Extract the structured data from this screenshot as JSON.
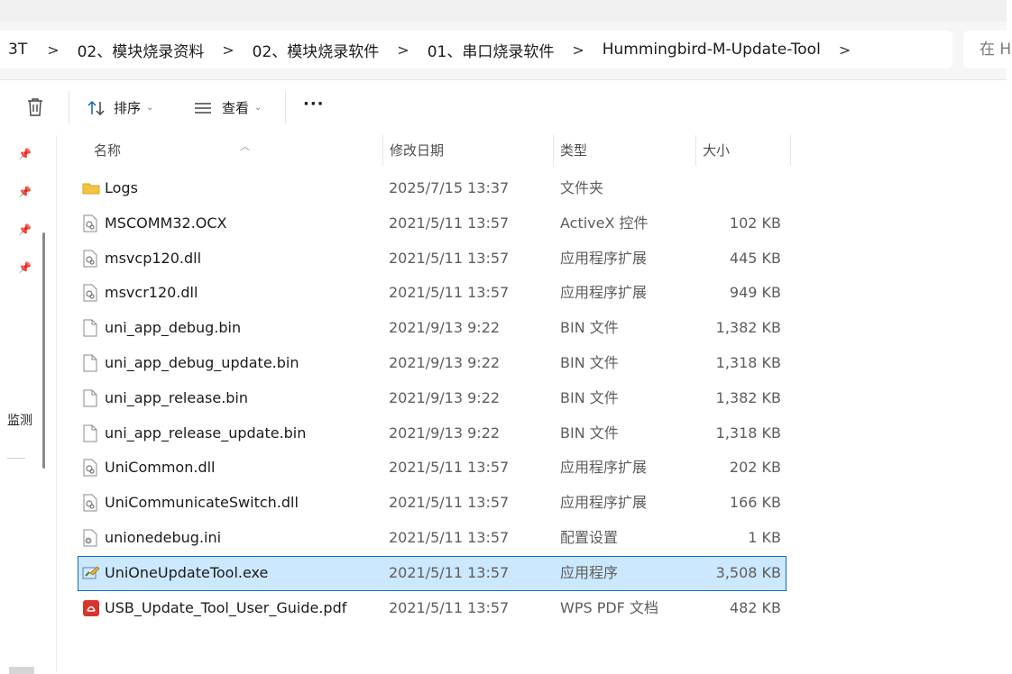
{
  "breadcrumb": {
    "items": [
      "3T",
      "02、模块烧录资料",
      "02、模块烧录软件",
      "01、串口烧录软件",
      "Hummingbird-M-Update-Tool"
    ],
    "separator": ">"
  },
  "search": {
    "placeholder": "在 H"
  },
  "toolbar": {
    "sort_label": "排序",
    "view_label": "查看",
    "more_label": "···"
  },
  "nav": {
    "partial_label": "监测"
  },
  "columns": {
    "name": "名称",
    "date": "修改日期",
    "type": "类型",
    "size": "大小"
  },
  "files": [
    {
      "name": "Logs",
      "date": "2025/7/15 13:37",
      "type": "文件夹",
      "size": "",
      "icon": "folder-icon"
    },
    {
      "name": "MSCOMM32.OCX",
      "date": "2021/5/11 13:57",
      "type": "ActiveX 控件",
      "size": "102 KB",
      "icon": "system-file-icon"
    },
    {
      "name": "msvcp120.dll",
      "date": "2021/5/11 13:57",
      "type": "应用程序扩展",
      "size": "445 KB",
      "icon": "system-file-icon"
    },
    {
      "name": "msvcr120.dll",
      "date": "2021/5/11 13:57",
      "type": "应用程序扩展",
      "size": "949 KB",
      "icon": "system-file-icon"
    },
    {
      "name": "uni_app_debug.bin",
      "date": "2021/9/13 9:22",
      "type": "BIN 文件",
      "size": "1,382 KB",
      "icon": "blank-file-icon"
    },
    {
      "name": "uni_app_debug_update.bin",
      "date": "2021/9/13 9:22",
      "type": "BIN 文件",
      "size": "1,318 KB",
      "icon": "blank-file-icon"
    },
    {
      "name": "uni_app_release.bin",
      "date": "2021/9/13 9:22",
      "type": "BIN 文件",
      "size": "1,382 KB",
      "icon": "blank-file-icon"
    },
    {
      "name": "uni_app_release_update.bin",
      "date": "2021/9/13 9:22",
      "type": "BIN 文件",
      "size": "1,318 KB",
      "icon": "blank-file-icon"
    },
    {
      "name": "UniCommon.dll",
      "date": "2021/5/11 13:57",
      "type": "应用程序扩展",
      "size": "202 KB",
      "icon": "system-file-icon"
    },
    {
      "name": "UniCommunicateSwitch.dll",
      "date": "2021/5/11 13:57",
      "type": "应用程序扩展",
      "size": "166 KB",
      "icon": "system-file-icon"
    },
    {
      "name": "unionedebug.ini",
      "date": "2021/5/11 13:57",
      "type": "配置设置",
      "size": "1 KB",
      "icon": "settings-file-icon"
    },
    {
      "name": "UniOneUpdateTool.exe",
      "date": "2021/5/11 13:57",
      "type": "应用程序",
      "size": "3,508 KB",
      "icon": "application-icon",
      "selected": true
    },
    {
      "name": "USB_Update_Tool_User_Guide.pdf",
      "date": "2021/5/11 13:57",
      "type": "WPS PDF 文档",
      "size": "482 KB",
      "icon": "pdf-icon"
    }
  ]
}
